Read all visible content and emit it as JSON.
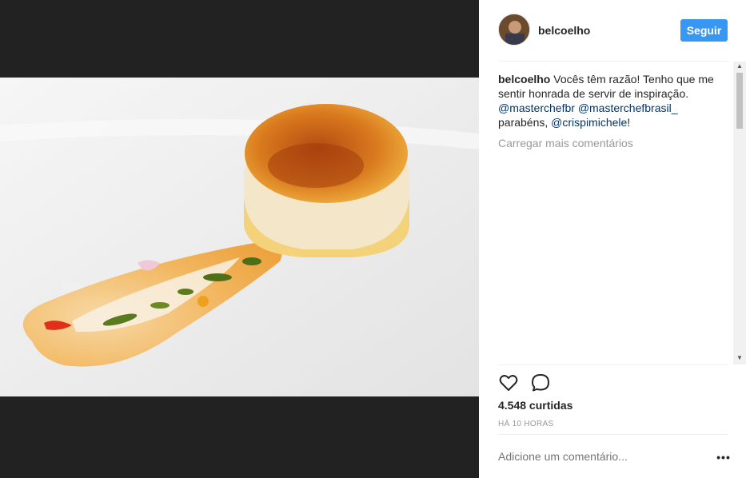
{
  "post": {
    "username": "belcoelho",
    "follow_label": "Seguir"
  },
  "caption": {
    "user": "belcoelho",
    "text_part1": " Vocês têm razão! Tenho que me sentir honrada de servir de inspiração. ",
    "mention1": "@masterchefbr",
    "mention2": "@masterchefbrasil_",
    "text_part2": " parabéns, ",
    "mention3": "@crispimichele",
    "text_part3": "!"
  },
  "load_more_label": "Carregar mais comentários",
  "likes_label": "4.548 curtidas",
  "time_label": "HÁ 10 HORAS",
  "comment_placeholder": "Adicione um comentário...",
  "more_label": "•••",
  "icons": {
    "like": "heart-icon",
    "comment": "comment-icon",
    "more": "more-options-icon"
  },
  "colors": {
    "follow_button": "#3897f0",
    "mention": "#003569",
    "muted": "#999999",
    "media_background": "#222222"
  }
}
